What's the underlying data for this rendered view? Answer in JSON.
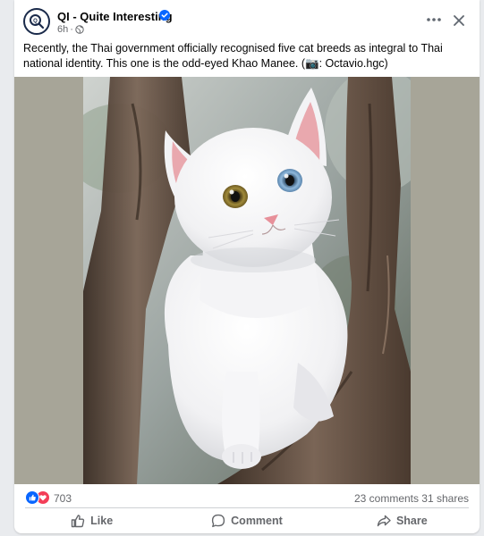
{
  "post": {
    "page_name": "QI - Quite Interesting",
    "time": "6h",
    "dot": "·",
    "caption": "Recently, the Thai government officially recognised five cat breeds as integral to Thai national identity. This one is the odd-eyed Khao Manee.  (📷: Octavio.hgc)",
    "icons": {
      "avatar": "qi-magnifier-logo",
      "verified": "verified-badge-icon",
      "privacy": "globe-icon",
      "more": "more-horizontal-icon",
      "close": "close-icon"
    }
  },
  "photo": {
    "subject": "white odd-eyed cat on tree branch",
    "background_color": "#a7a598"
  },
  "stats": {
    "reactions": "703",
    "comments": "23 comments",
    "shares": "31 shares",
    "reaction_icons": [
      "like-reaction-icon",
      "love-reaction-icon"
    ]
  },
  "actions": {
    "like": "Like",
    "comment": "Comment",
    "share": "Share"
  },
  "colors": {
    "brand_blue": "#0866ff",
    "love_red": "#f33e58",
    "secondary_text": "#65676b",
    "primary_text": "#050505"
  }
}
